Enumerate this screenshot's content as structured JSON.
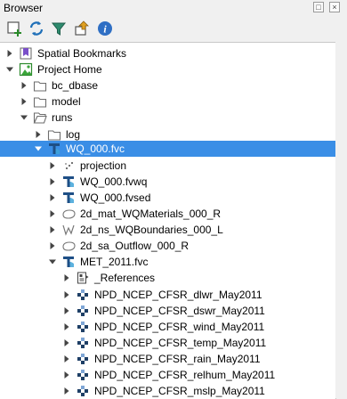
{
  "panel": {
    "title": "Browser"
  },
  "toolbar": {
    "buttons": [
      "add-layer-icon",
      "refresh-icon",
      "filter-icon",
      "collapse-icon",
      "info-icon"
    ]
  },
  "tree": {
    "items": [
      {
        "label": "Spatial Bookmarks",
        "icon": "bookmark-icon",
        "expanded": false
      },
      {
        "label": "Project Home",
        "icon": "project-home-icon",
        "expanded": true
      },
      {
        "label": "bc_dbase",
        "icon": "folder-icon",
        "expanded": false
      },
      {
        "label": "model",
        "icon": "folder-icon",
        "expanded": false
      },
      {
        "label": "runs",
        "icon": "folder-open-icon",
        "expanded": true
      },
      {
        "label": "log",
        "icon": "folder-icon",
        "expanded": false
      },
      {
        "label": "WQ_000.fvc",
        "icon": "fvc-icon",
        "expanded": true,
        "selected": true
      },
      {
        "label": "projection",
        "icon": "points-icon",
        "expanded": false
      },
      {
        "label": "WQ_000.fvwq",
        "icon": "fvc-icon",
        "expanded": false
      },
      {
        "label": "WQ_000.fvsed",
        "icon": "fvc-icon",
        "expanded": false
      },
      {
        "label": "2d_mat_WQMaterials_000_R",
        "icon": "polygon-icon",
        "expanded": false
      },
      {
        "label": "2d_ns_WQBoundaries_000_L",
        "icon": "line-icon",
        "expanded": false
      },
      {
        "label": "2d_sa_Outflow_000_R",
        "icon": "polygon-icon",
        "expanded": false
      },
      {
        "label": "MET_2011.fvc",
        "icon": "fvc-icon",
        "expanded": true
      },
      {
        "label": "_References",
        "icon": "references-icon",
        "expanded": false
      },
      {
        "label": "NPD_NCEP_CFSR_dlwr_May2011",
        "icon": "raster-icon",
        "expanded": false
      },
      {
        "label": "NPD_NCEP_CFSR_dswr_May2011",
        "icon": "raster-icon",
        "expanded": false
      },
      {
        "label": "NPD_NCEP_CFSR_wind_May2011",
        "icon": "raster-icon",
        "expanded": false
      },
      {
        "label": "NPD_NCEP_CFSR_temp_May2011",
        "icon": "raster-icon",
        "expanded": false
      },
      {
        "label": "NPD_NCEP_CFSR_rain_May2011",
        "icon": "raster-icon",
        "expanded": false
      },
      {
        "label": "NPD_NCEP_CFSR_relhum_May2011",
        "icon": "raster-icon",
        "expanded": false
      },
      {
        "label": "NPD_NCEP_CFSR_mslp_May2011",
        "icon": "raster-icon",
        "expanded": false
      }
    ]
  },
  "colors": {
    "selection": "#3a8ee6",
    "accent": "#1e6fb8",
    "folder": "#6d6d6d"
  }
}
